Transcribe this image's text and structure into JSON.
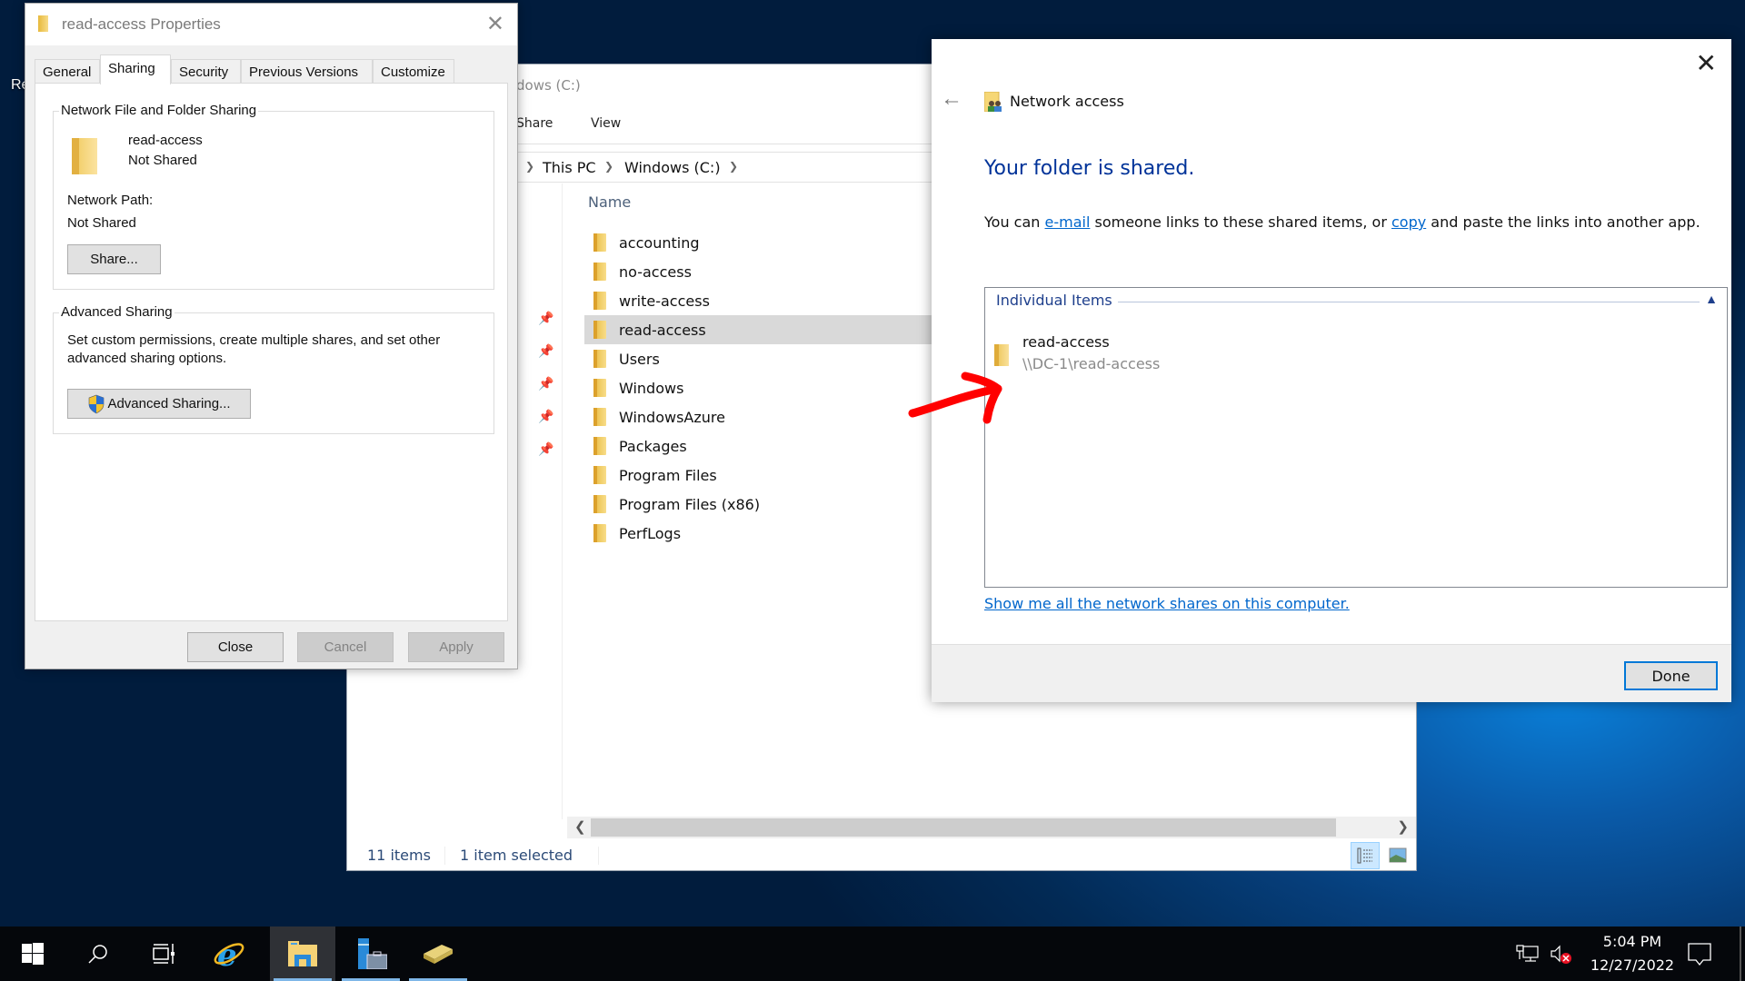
{
  "desktop": {
    "label_fragment": "Re"
  },
  "explorer": {
    "title_fragment": "dows (C:)",
    "ribbon_tabs": [
      "Share",
      "View"
    ],
    "breadcrumb": [
      "This PC",
      "Windows (C:)"
    ],
    "column_header": "Name",
    "files": [
      {
        "name": "accounting",
        "selected": false
      },
      {
        "name": "no-access",
        "selected": false
      },
      {
        "name": "write-access",
        "selected": false
      },
      {
        "name": "read-access",
        "selected": true
      },
      {
        "name": "Users",
        "selected": false
      },
      {
        "name": "Windows",
        "selected": false
      },
      {
        "name": "WindowsAzure",
        "selected": false
      },
      {
        "name": "Packages",
        "selected": false
      },
      {
        "name": "Program Files",
        "selected": false
      },
      {
        "name": "Program Files (x86)",
        "selected": false
      },
      {
        "name": "PerfLogs",
        "selected": false
      }
    ],
    "status": {
      "item_count": "11 items",
      "selection": "1 item selected"
    }
  },
  "properties": {
    "title": "read-access Properties",
    "tabs": [
      "General",
      "Sharing",
      "Security",
      "Previous Versions",
      "Customize"
    ],
    "active_tab": "Sharing",
    "network_sharing": {
      "legend": "Network File and Folder Sharing",
      "folder_name": "read-access",
      "folder_status": "Not Shared",
      "path_label": "Network Path:",
      "path_value": "Not Shared",
      "share_button": "Share..."
    },
    "advanced_sharing": {
      "legend": "Advanced Sharing",
      "description": "Set custom permissions, create multiple shares, and set other advanced sharing options.",
      "button": "Advanced Sharing..."
    },
    "buttons": {
      "close": "Close",
      "cancel": "Cancel",
      "apply": "Apply"
    }
  },
  "network_access": {
    "title": "Network access",
    "heading": "Your folder is shared.",
    "desc_prefix": "You can ",
    "email_link": "e-mail",
    "desc_mid": " someone links to these shared items, or ",
    "copy_link": "copy",
    "desc_suffix": " and paste the links into another app.",
    "items_legend": "Individual Items",
    "shared_item": {
      "name": "read-access",
      "path": "\\\\DC-1\\read-access"
    },
    "show_all_link": "Show me all the network shares on this computer.",
    "done_button": "Done"
  },
  "taskbar": {
    "time": "5:04 PM",
    "date": "12/27/2022",
    "colors": {
      "accent": "#0078d7",
      "link": "#0066cc",
      "heading": "#003399",
      "annotation": "#ff0000"
    }
  }
}
